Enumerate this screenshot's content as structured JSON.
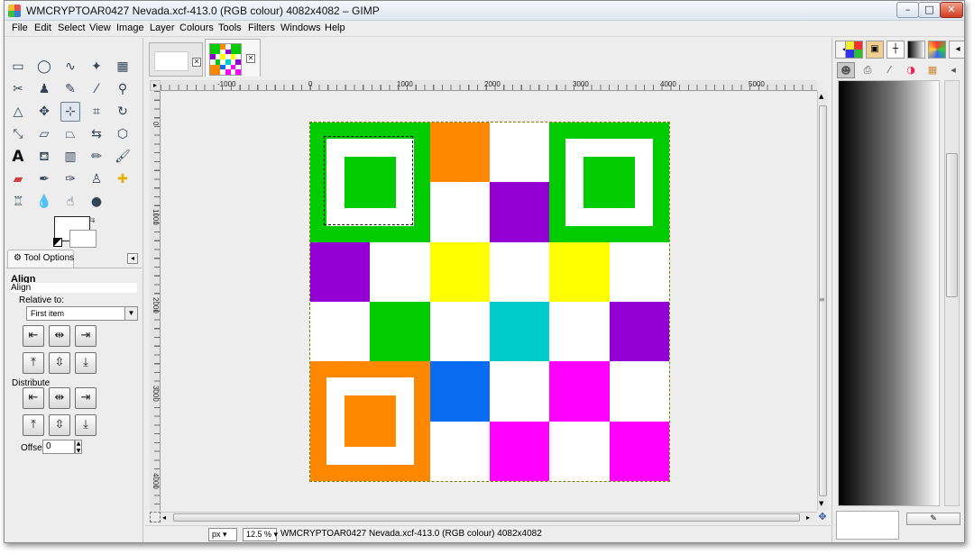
{
  "window": {
    "title": "WMCRYPTOAR0427 Nevada.xcf-413.0 (RGB colour) 4082x4082 – GIMP",
    "minimize": "–",
    "maximize": "□",
    "close": "✕"
  },
  "menu": [
    "File",
    "Edit",
    "Select",
    "View",
    "Image",
    "Layer",
    "Colours",
    "Tools",
    "Filters",
    "Windows",
    "Help"
  ],
  "tool_options": {
    "tab_label": "Tool Options",
    "heading": "Align",
    "subheading": "Align",
    "relative_label": "Relative to:",
    "relative_value": "First item",
    "distribute_label": "Distribute",
    "offset_label": "Offset:",
    "offset_value": "0"
  },
  "rulers": {
    "h_labels": [
      "-1000",
      "0",
      "1000",
      "2000",
      "3000",
      "4000",
      "5000"
    ],
    "v_labels": [
      "0",
      "1000",
      "2000",
      "3000",
      "4000"
    ]
  },
  "status": {
    "unit": "px",
    "zoom": "12.5 %",
    "text": "WMCRYPTOAR0427 Nevada.xcf-413.0 (RGB colour) 4082x4082"
  },
  "qr_colors": {
    "green": "#00cc00",
    "orange": "#ff8800",
    "purple": "#9400d3",
    "yellow": "#ffff00",
    "cyan": "#00cccc",
    "blue": "#0a6cf0",
    "magenta": "#ff00ff",
    "white": "#ffffff"
  },
  "qr_grid": [
    [
      "",
      "",
      "orange",
      "white",
      "",
      ""
    ],
    [
      "",
      "",
      "white",
      "purple",
      "",
      ""
    ],
    [
      "purple",
      "white",
      "yellow",
      "white",
      "yellow",
      "white"
    ],
    [
      "white",
      "green",
      "white",
      "cyan",
      "white",
      "purple"
    ],
    [
      "",
      "",
      "blue",
      "white",
      "magenta",
      "white"
    ],
    [
      "",
      "",
      "white",
      "magenta",
      "white",
      "magenta"
    ]
  ]
}
